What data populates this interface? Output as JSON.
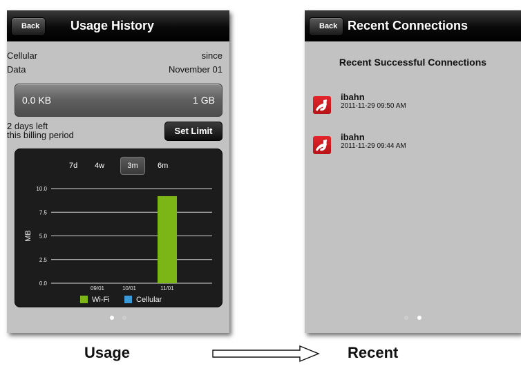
{
  "left_screen": {
    "nav": {
      "back_label": "Back",
      "title": "Usage History"
    },
    "plan": {
      "type_line1": "Cellular",
      "type_line2": "Data",
      "since_label": "since",
      "since_date": "November 01",
      "used": "0.0 KB",
      "limit": "1 GB",
      "used_fraction": 0.0
    },
    "billing_line1": "2 days left",
    "billing_line2": "this billing period",
    "set_limit_label": "Set Limit",
    "periods": [
      "7d",
      "4w",
      "3m",
      "6m"
    ],
    "selected_period": "3m",
    "page_indicator": {
      "count": 2,
      "active": 0
    }
  },
  "chart_data": {
    "type": "bar",
    "categories": [
      "09/01",
      "10/01",
      "11/01"
    ],
    "series": [
      {
        "name": "Wi-Fi",
        "values": [
          0,
          0,
          9.2
        ],
        "color": "#7cb516"
      },
      {
        "name": "Cellular",
        "values": [
          0,
          0,
          0
        ],
        "color": "#3a9ad9"
      }
    ],
    "ylabel": "MB",
    "ylim": [
      0,
      10
    ],
    "yticks": [
      "0.0",
      "2.5",
      "5.0",
      "7.5",
      "10.0"
    ],
    "grid": true,
    "legend": "bottom"
  },
  "right_screen": {
    "nav": {
      "back_label": "Back",
      "title": "Recent Connections"
    },
    "section_title": "Recent Successful Connections",
    "connections": [
      {
        "name": "ibahn",
        "time": "2011-11-29 09:50 AM",
        "icon": "ibahn-logo-icon"
      },
      {
        "name": "ibahn",
        "time": "2011-11-29 09:44 AM",
        "icon": "ibahn-logo-icon"
      }
    ],
    "page_indicator": {
      "count": 2,
      "active": 1
    }
  },
  "captions": {
    "left": "Usage",
    "right": "Recent"
  }
}
